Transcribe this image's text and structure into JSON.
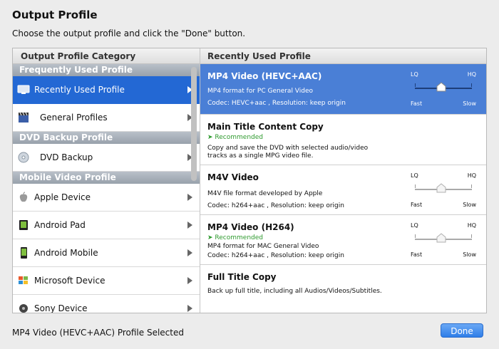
{
  "window": {
    "title": "Output Profile",
    "instruction": "Choose the output profile and click the \"Done\" button."
  },
  "left_panel": {
    "header": "Output Profile Category",
    "groups": [
      {
        "label": "Frequently Used Profile",
        "items": [
          {
            "label": "Recently Used Profile",
            "icon": "monitor-icon",
            "selected": true
          },
          {
            "label": "General Profiles",
            "icon": "film-icon",
            "selected": false
          }
        ]
      },
      {
        "label": "DVD Backup Profile",
        "items": [
          {
            "label": "DVD Backup",
            "icon": "disc-icon",
            "selected": false
          }
        ]
      },
      {
        "label": "Mobile Video Profile",
        "items": [
          {
            "label": "Apple Device",
            "icon": "apple-icon",
            "selected": false
          },
          {
            "label": "Android Pad",
            "icon": "android-pad-icon",
            "selected": false
          },
          {
            "label": "Android Mobile",
            "icon": "android-phone-icon",
            "selected": false
          },
          {
            "label": "Microsoft Device",
            "icon": "windows-icon",
            "selected": false
          },
          {
            "label": "Sony Device",
            "icon": "sony-icon",
            "selected": false
          }
        ]
      }
    ]
  },
  "right_panel": {
    "header": "Recently Used Profile",
    "profiles": [
      {
        "name": "MP4 Video (HEVC+AAC)",
        "recommended": "",
        "description": "MP4 format for PC General Video",
        "codec": "Codec: HEVC+aac , Resolution: keep origin",
        "selected": true,
        "has_slider": true
      },
      {
        "name": "Main Title Content Copy",
        "recommended": "➤ Recommended",
        "description": "Copy and save the DVD with selected audio/video tracks as a single MPG video file.",
        "codec": "",
        "selected": false,
        "has_slider": false
      },
      {
        "name": "M4V Video",
        "recommended": "",
        "description": "M4V file format developed by Apple",
        "codec": "Codec: h264+aac , Resolution: keep origin",
        "selected": false,
        "has_slider": true
      },
      {
        "name": "MP4 Video (H264)",
        "recommended": "➤ Recommended",
        "description": "MP4 format for MAC General Video",
        "codec": "Codec: h264+aac , Resolution: keep origin",
        "selected": false,
        "has_slider": true
      },
      {
        "name": "Full Title Copy",
        "recommended": "",
        "description": "Back up full title, including all Audios/Videos/Subtitles.",
        "codec": "",
        "selected": false,
        "has_slider": false
      }
    ],
    "slider_labels": {
      "lq": "LQ",
      "hq": "HQ",
      "fast": "Fast",
      "slow": "Slow"
    }
  },
  "footer": {
    "status": "MP4 Video (HEVC+AAC) Profile Selected",
    "done_label": "Done"
  },
  "colors": {
    "selection_blue": "#2368d4",
    "selected_profile_blue": "#4a7fd6",
    "recommended_green": "#2e9a2e",
    "done_button": "#2f7ee8"
  }
}
